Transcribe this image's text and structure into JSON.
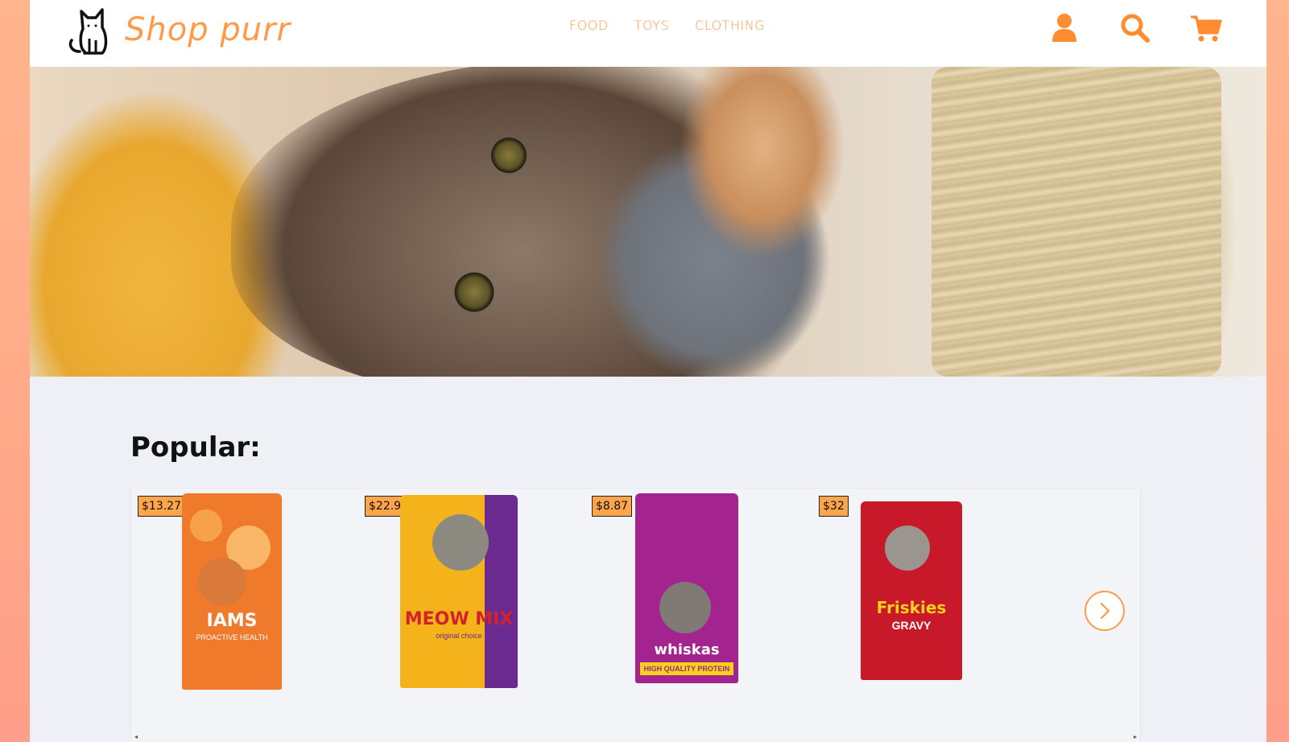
{
  "header": {
    "logo_text": "Shop purr",
    "nav": [
      "FOOD",
      "TOYS",
      "CLOTHING"
    ],
    "icons": [
      "user-icon",
      "search-icon",
      "cart-icon"
    ]
  },
  "hero": {
    "slides_count": 3,
    "active_slide": 1
  },
  "popular": {
    "title": "Popular:",
    "products": [
      {
        "price": "$13.27",
        "brand": "IAMS",
        "sub": "PROACTIVE HEALTH",
        "color": "#f07a2b"
      },
      {
        "price": "$22.98",
        "brand": "MEOW MIX",
        "sub": "original choice",
        "color": "#f4b21b"
      },
      {
        "price": "$8.87",
        "brand": "whiskas",
        "sub": "HIGH QUALITY PROTEIN",
        "color": "#a3238f"
      },
      {
        "price": "$32",
        "brand": "Friskies",
        "sub": "GRAVY",
        "color": "#c8192b"
      }
    ]
  },
  "colors": {
    "accent": "#ff9a4a",
    "background": "#eef0f5"
  }
}
